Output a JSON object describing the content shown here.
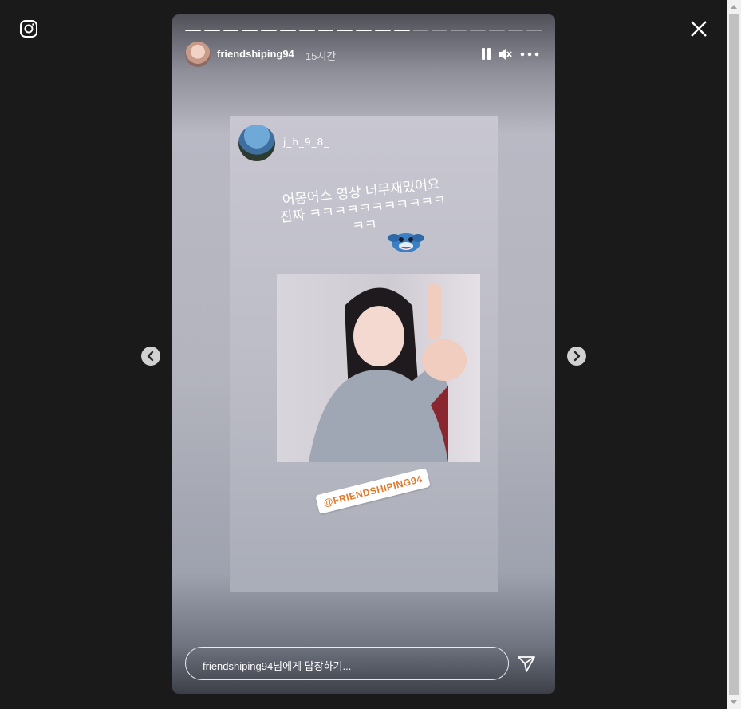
{
  "story": {
    "username": "friendshiping94",
    "time_ago": "15시간",
    "progress": {
      "total_segments": 19,
      "completed_segments": 12
    },
    "reply_placeholder": "friendshiping94님에게 답장하기..."
  },
  "shared_post": {
    "username": "j_h_9_8_",
    "caption_line1": "어몽어스 영상 너무재밌어요",
    "caption_line2": "진짜 ㅋㅋㅋㅋㅋㅋㅋㅋㅋㅋㅋ",
    "caption_line3": "ㅋㅋ",
    "mention": "@FRIENDSHIPING94"
  },
  "icons": {
    "logo": "instagram-icon",
    "close": "close-icon",
    "pause": "pause-icon",
    "mute": "mute-icon",
    "more": "more-icon",
    "send": "send-icon",
    "prev": "chevron-left-icon",
    "next": "chevron-right-icon"
  },
  "colors": {
    "background": "#1a1a1a",
    "mention_text": "#e07a2a"
  }
}
